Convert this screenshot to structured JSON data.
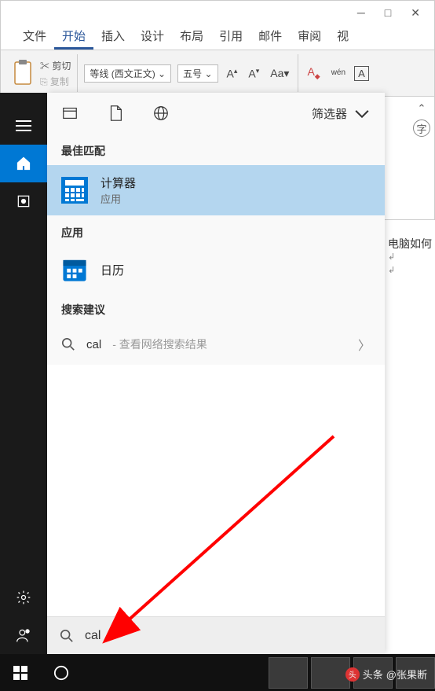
{
  "ribbon": {
    "tabs": [
      "文件",
      "开始",
      "插入",
      "设计",
      "布局",
      "引用",
      "邮件",
      "审阅",
      "视"
    ],
    "active_tab": "开始",
    "cut_label": "剪切",
    "font_family": "等线 (西文正文)",
    "font_size": "五号",
    "pinyin_label": "wén",
    "char_box": "A",
    "style_label": "字"
  },
  "doc": {
    "heading": "电脑如何",
    "marker": "↲"
  },
  "search": {
    "filter_label": "筛选器",
    "sections": {
      "best_match": "最佳匹配",
      "apps": "应用",
      "suggestions": "搜索建议"
    },
    "best_match": {
      "title": "计算器",
      "subtitle": "应用"
    },
    "app_item": "日历",
    "suggest_term": "cal",
    "suggest_hint": " - 查看网络搜索结果",
    "input_value": "cal"
  },
  "watermark": {
    "prefix": "头条",
    "author": "@张果断"
  }
}
